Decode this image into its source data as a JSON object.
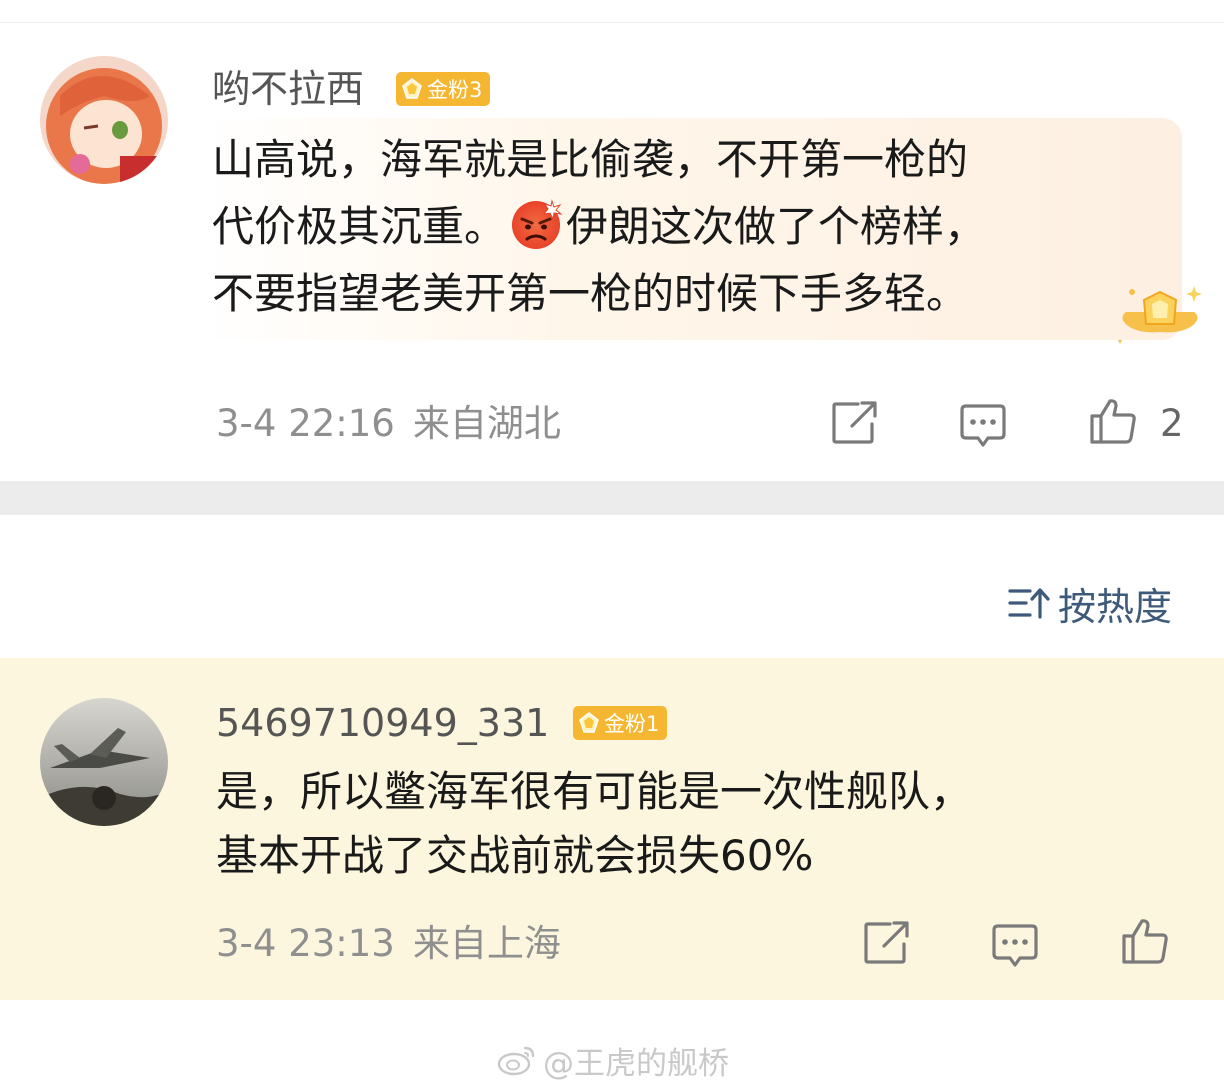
{
  "comments": [
    {
      "username": "哟不拉西",
      "badge": "金粉3",
      "lines": [
        "山高说，海军就是比偷袭，不开第一枪的",
        "代价极其沉重。",
        "伊朗这次做了个榜样，",
        "不要指望老美开第一枪的时候下手多轻。"
      ],
      "emoji": "angry-face-emoji",
      "time": "3-4 22:16",
      "location": "来自湖北",
      "likes": "2"
    },
    {
      "username": "5469710949_331",
      "badge": "金粉1",
      "lines": [
        "是，所以鳖海军很有可能是一次性舰队，",
        "基本开战了交战前就会损失60%"
      ],
      "time": "3-4 23:13",
      "location": "来自上海",
      "likes": ""
    }
  ],
  "sort": {
    "label": "按热度"
  },
  "watermark": "@王虎的舰桥",
  "colors": {
    "badge": "#f5b731",
    "highlight_row": "#fdf6de",
    "sort_text": "#3d5a7a",
    "meta_text": "#8f8f8f",
    "divider": "#ececec"
  },
  "icons": [
    "share-icon",
    "comment-icon",
    "like-icon",
    "sort-icon",
    "weibo-logo-icon",
    "gold-fan-gem-icon"
  ]
}
